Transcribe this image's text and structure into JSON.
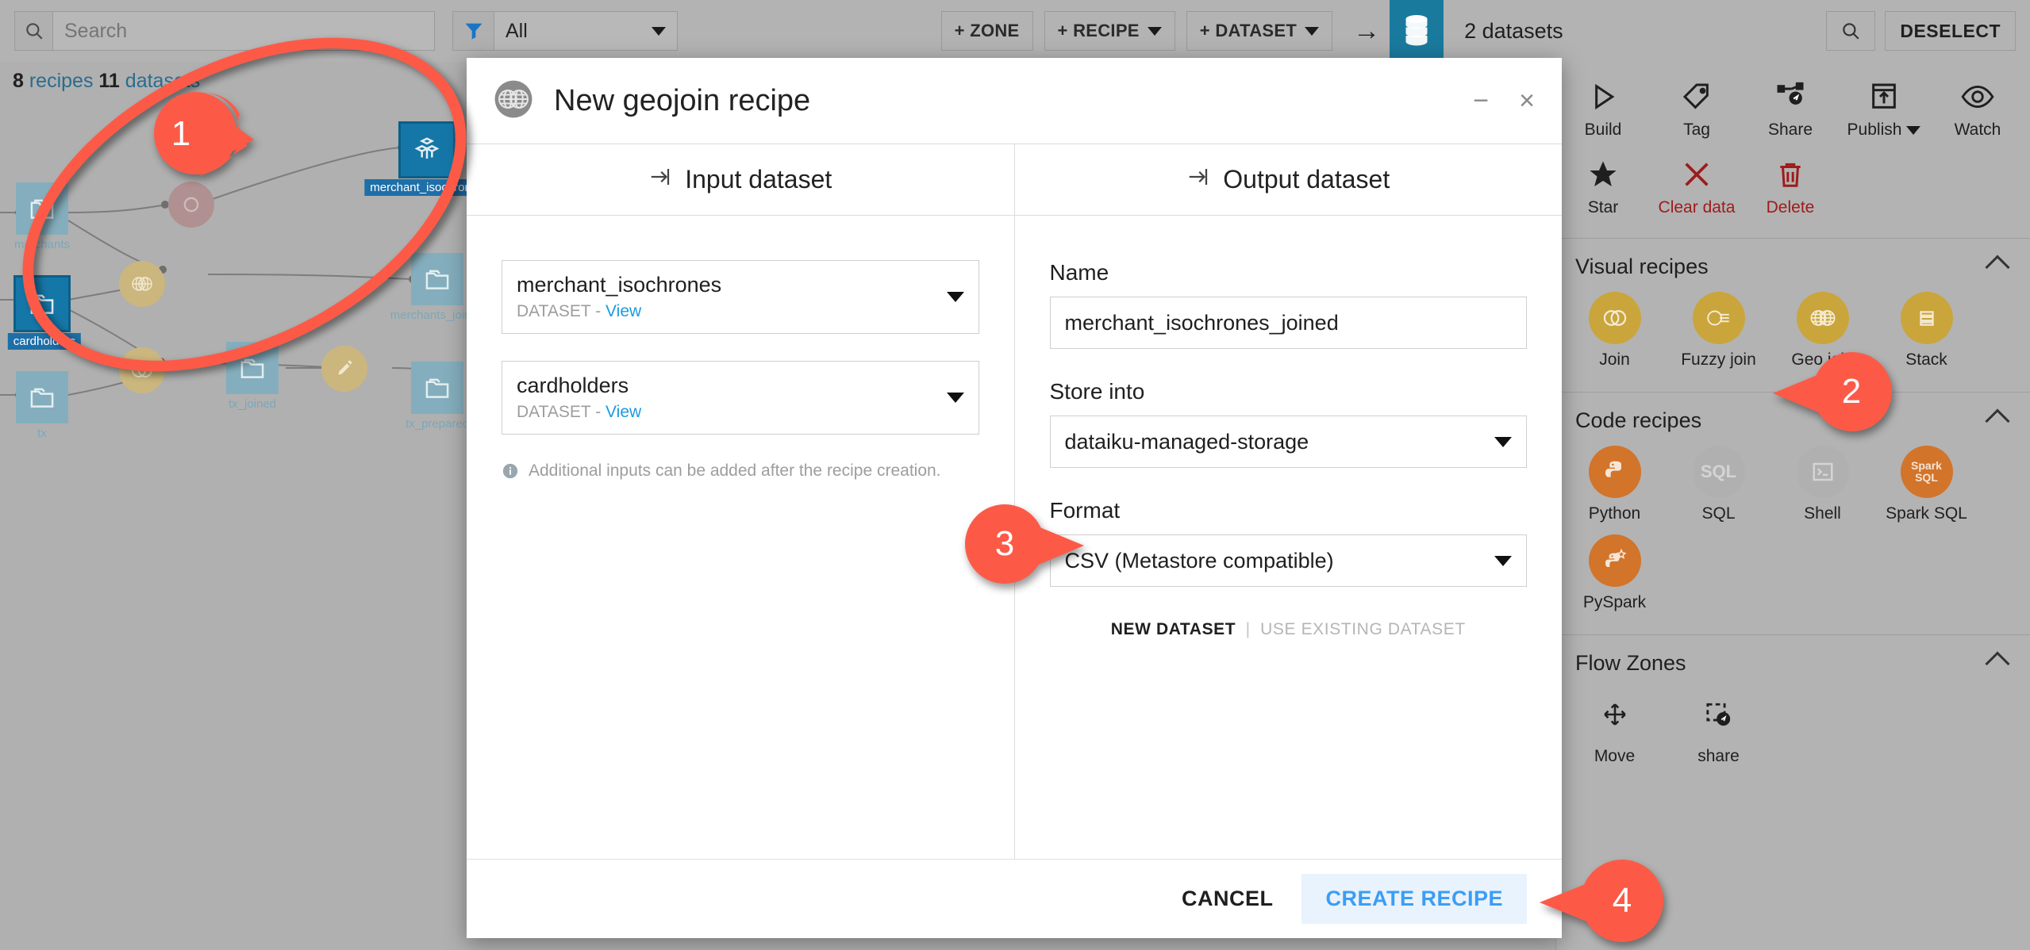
{
  "topbar": {
    "search_placeholder": "Search",
    "search_value": "",
    "search_icon": "search-icon",
    "filter_icon": "filter-funnel-icon",
    "filter_value": "All",
    "zone_button": "+ ZONE",
    "recipe_button": "+ RECIPE",
    "dataset_button": "+ DATASET",
    "arrow_icon": "arrow-right-icon",
    "db_icon": "database-icon",
    "selection_count": "2 datasets",
    "search_selection_icon": "search-icon",
    "deselect_button": "DESELECT"
  },
  "flow": {
    "stats_recipes_count": "8",
    "stats_recipes_word": "recipes",
    "stats_datasets_count": "11",
    "stats_datasets_word": "datasets",
    "nodes": [
      {
        "label": "merchants",
        "selected": false
      },
      {
        "label": "cardholders",
        "selected": true
      },
      {
        "label": "tx",
        "selected": false
      },
      {
        "label": "merchant_isochrones",
        "selected": true
      },
      {
        "label": "merchants_joined",
        "selected": false
      },
      {
        "label": "tx_joined",
        "selected": false
      },
      {
        "label": "tx_prepared",
        "selected": false
      }
    ]
  },
  "sidebar": {
    "actions": [
      {
        "label": "Build",
        "icon": "play-triangle-icon",
        "danger": false,
        "caret": false
      },
      {
        "label": "Tag",
        "icon": "tag-icon",
        "danger": false,
        "caret": false
      },
      {
        "label": "Share",
        "icon": "share-nodes-icon",
        "danger": false,
        "caret": false
      },
      {
        "label": "Publish",
        "icon": "publish-upload-icon",
        "danger": false,
        "caret": true
      },
      {
        "label": "Watch",
        "icon": "eye-icon",
        "danger": false,
        "caret": false
      },
      {
        "label": "Star",
        "icon": "star-icon",
        "danger": false,
        "caret": false
      },
      {
        "label": "Clear data",
        "icon": "x-cross-icon",
        "danger": true,
        "caret": false
      },
      {
        "label": "Delete",
        "icon": "trash-icon",
        "danger": true,
        "caret": false
      }
    ],
    "sections": [
      {
        "title": "Visual recipes",
        "collapse_icon": "chevron-up-icon",
        "items": [
          {
            "label": "Join",
            "icon": "join-circles-icon",
            "color": "#c9a53c"
          },
          {
            "label": "Fuzzy join",
            "icon": "fuzzy-join-icon",
            "color": "#c9a53c"
          },
          {
            "label": "Geo join",
            "icon": "geo-join-globes-icon",
            "color": "#c9a53c"
          },
          {
            "label": "Stack",
            "icon": "stack-icon",
            "color": "#c9a53c"
          }
        ]
      },
      {
        "title": "Code recipes",
        "collapse_icon": "chevron-up-icon",
        "items": [
          {
            "label": "Python",
            "icon": "python-icon",
            "color": "#d2742a"
          },
          {
            "label": "SQL",
            "icon": "sql-icon",
            "color": "#b0b0b0"
          },
          {
            "label": "Shell",
            "icon": "shell-terminal-icon",
            "color": "#b0b0b0"
          },
          {
            "label": "Spark SQL",
            "icon": "spark-sql-icon",
            "color": "#d2742a"
          },
          {
            "label": "PySpark",
            "icon": "pyspark-icon",
            "color": "#d2742a"
          }
        ]
      },
      {
        "title": "Flow Zones",
        "collapse_icon": "chevron-up-icon",
        "items": [
          {
            "label": "Move",
            "icon": "move-icon",
            "color": "none"
          },
          {
            "label": "share",
            "icon": "zone-share-icon",
            "color": "none"
          }
        ]
      }
    ]
  },
  "modal": {
    "icon": "geo-join-globes-icon",
    "title": "New geojoin recipe",
    "minimize_icon": "minimize-icon",
    "close_icon": "close-x-icon",
    "input_panel": {
      "header": "Input dataset",
      "header_icon": "arrow-into-icon",
      "datasets": [
        {
          "name": "merchant_isochrones",
          "type_label": "DATASET",
          "separator": "-",
          "view_link": "View"
        },
        {
          "name": "cardholders",
          "type_label": "DATASET",
          "separator": "-",
          "view_link": "View"
        }
      ],
      "hint_icon": "info-icon",
      "hint": "Additional inputs can be added after the recipe creation."
    },
    "output_panel": {
      "header": "Output dataset",
      "header_icon": "arrow-into-icon",
      "name_label": "Name",
      "name_value": "merchant_isochrones_joined",
      "store_label": "Store into",
      "store_value": "dataiku-managed-storage",
      "format_label": "Format",
      "format_value": "CSV (Metastore compatible)",
      "toggle_new": "NEW DATASET",
      "toggle_sep": "|",
      "toggle_existing": "USE EXISTING DATASET"
    },
    "cancel_button": "CANCEL",
    "create_button": "CREATE RECIPE"
  },
  "annotations": {
    "accent_color": "#fc5a47",
    "steps": [
      {
        "number": "1",
        "target": "selected-flow-datasets"
      },
      {
        "number": "2",
        "target": "geo-join-recipe-icon"
      },
      {
        "number": "3",
        "target": "format-select"
      },
      {
        "number": "4",
        "target": "create-recipe-button"
      }
    ]
  }
}
